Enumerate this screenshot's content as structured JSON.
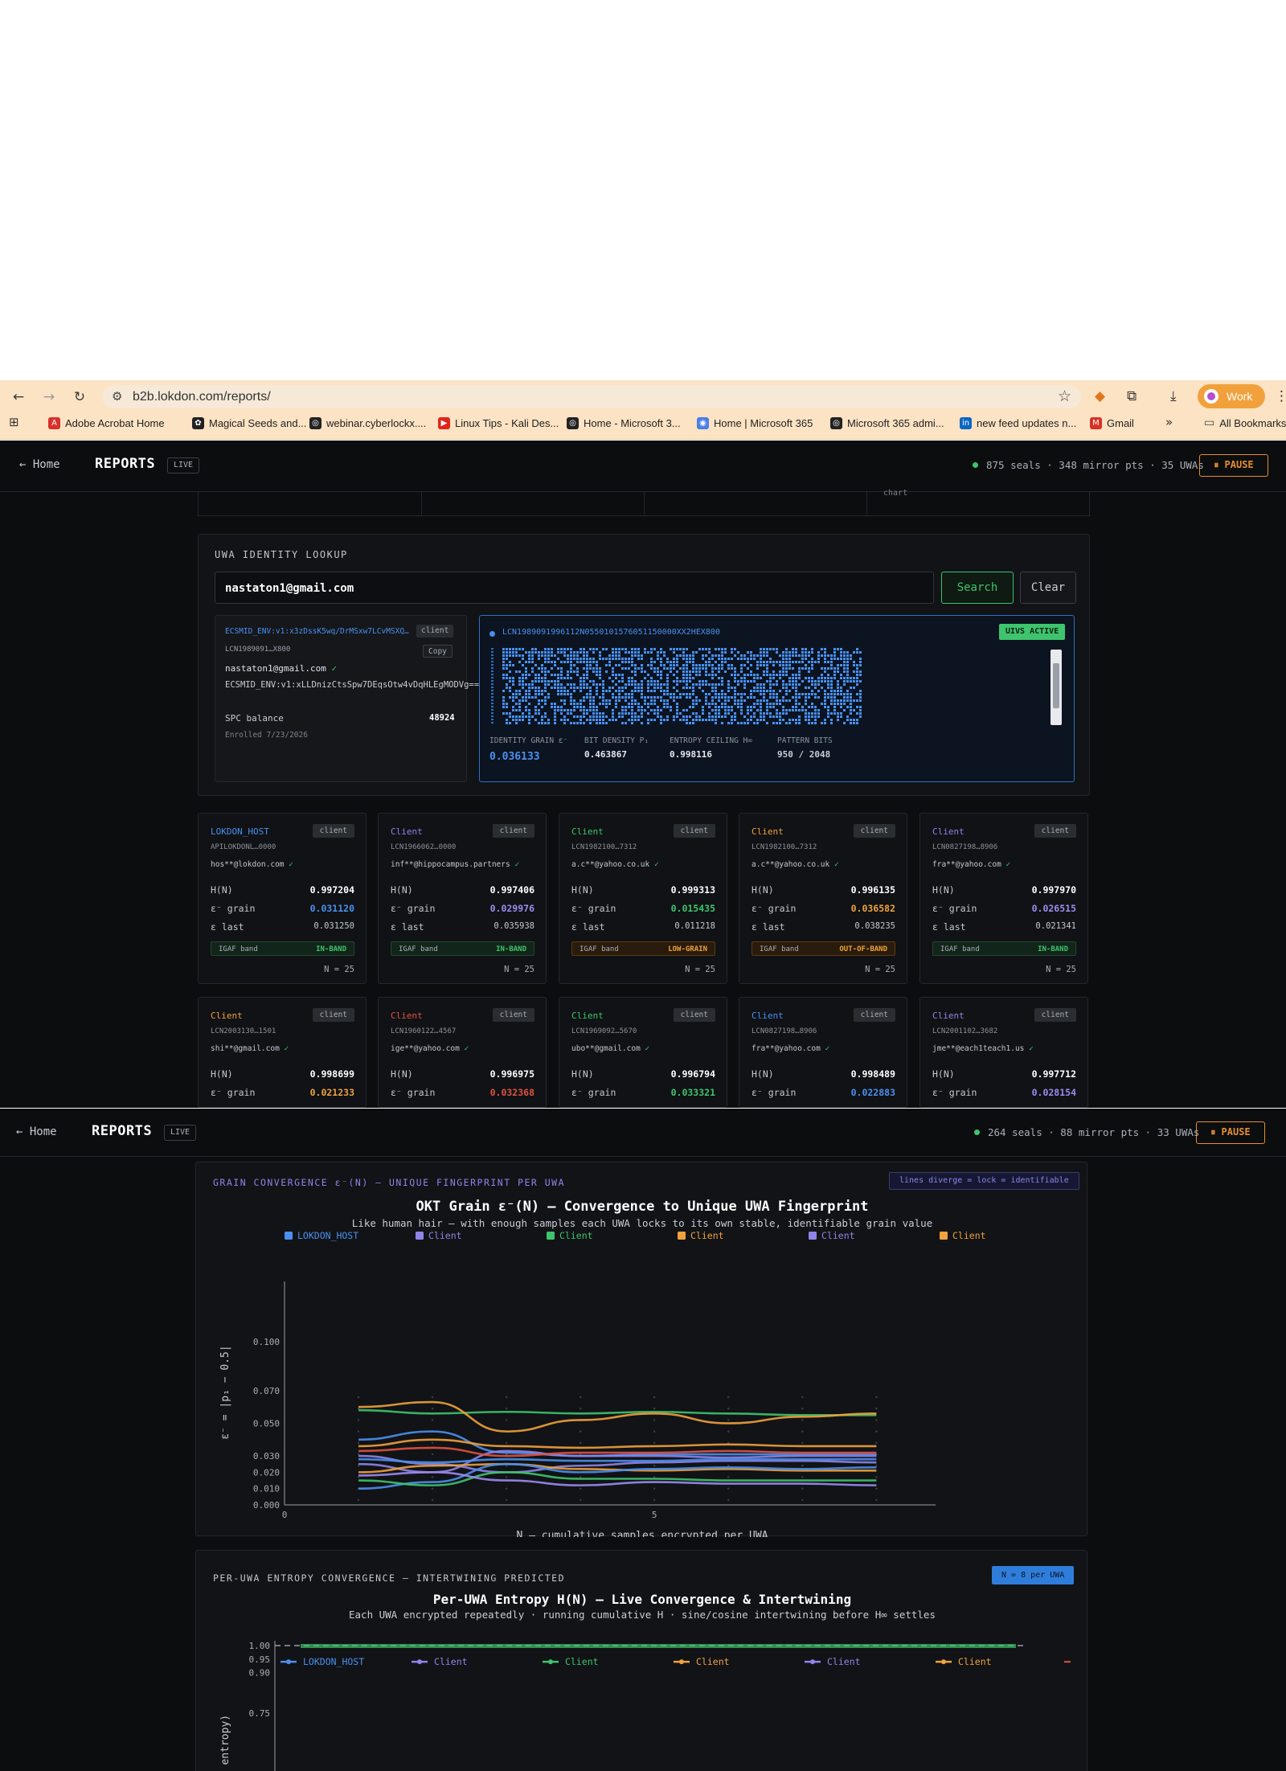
{
  "browser": {
    "url": "b2b.lokdon.com/reports/",
    "profile": "Work",
    "bookmarks": [
      {
        "label": "Adobe Acrobat Home",
        "icon": "acrobat-icon",
        "color": "#d8312a"
      },
      {
        "label": "Magical Seeds and...",
        "icon": "magical-seeds-icon",
        "color": "#222222"
      },
      {
        "label": "webinar.cyberlockx....",
        "icon": "globe-icon",
        "color": "#222222"
      },
      {
        "label": "Linux Tips - Kali Des...",
        "icon": "youtube-icon",
        "color": "#e0261b"
      },
      {
        "label": "Home - Microsoft 3...",
        "icon": "globe-icon",
        "color": "#222222"
      },
      {
        "label": "Home | Microsoft 365",
        "icon": "m365-icon",
        "color": "#4a7ee8"
      },
      {
        "label": "Microsoft 365 admi...",
        "icon": "globe-icon",
        "color": "#222222"
      },
      {
        "label": "new feed updates n...",
        "icon": "linkedin-icon",
        "color": "#0a66c2"
      },
      {
        "label": "Gmail",
        "icon": "gmail-icon",
        "color": "#d93025"
      }
    ],
    "all_bookmarks": "All Bookmarks"
  },
  "top_app": {
    "home": "← Home",
    "title": "REPORTS",
    "live": "LIVE",
    "status": "875 seals · 348 mirror pts · 35 UWAs",
    "pause": "⏸ PAUSE",
    "clipped_text": "chart"
  },
  "lookup": {
    "title": "UWA IDENTITY LOOKUP",
    "query": "nastaton1@gmail.com",
    "search": "Search",
    "clear": "Clear",
    "env_id": "ECSMID_ENV:v1:x3zDssK5wq/DrMSxw7LCvMSXQ…",
    "client_tag": "client",
    "lcn": "LCN1989091…X800",
    "copy": "Copy",
    "email": "nastaton1@gmail.com",
    "check": "✓",
    "env_full": "ECSMID_ENV:v1:xLLDnizCtsSpw7DEqsOtw4vDqHLEgMODVg==",
    "balance_label": "SPC balance",
    "balance": "48924",
    "enrolled": "Enrolled 7/23/2026",
    "fingerprint_id": "LCN1989091996112N0550101576051150000XX2HEX800",
    "uivs": "UIVS ACTIVE",
    "metrics": [
      {
        "label": "IDENTITY GRAIN ε⁻",
        "value": "0.036133",
        "color": "#4a90f0"
      },
      {
        "label": "BIT DENSITY P₁",
        "value": "0.463867",
        "color": "#e6e9ee"
      },
      {
        "label": "ENTROPY CEILING H∞",
        "value": "0.998116",
        "color": "#e6e9ee"
      },
      {
        "label": "PATTERN BITS",
        "value": "950 / 2048",
        "color": "#c9ced5"
      }
    ]
  },
  "uwa_cards": [
    {
      "name": "LOKDON_HOST",
      "color": "#4a90f0",
      "tag": "client",
      "lcn": "APILOKDONL…0000",
      "email": "hos**@lokdon.com",
      "check": "✓",
      "h_label": "H(N)",
      "h": "0.997204",
      "grain_label": "ε⁻ grain",
      "grain": "0.031120",
      "grain_color": "#4a90f0",
      "last_label": "ε last",
      "last": "0.031250",
      "band_label": "IGAF band",
      "band": "IN-BAND",
      "band_kind": "in",
      "n": "N = 25"
    },
    {
      "name": "Client",
      "color": "#8f84e8",
      "tag": "client",
      "lcn": "LCN1966062…0000",
      "email": "inf**@hippocampus.partners",
      "check": "✓",
      "h_label": "H(N)",
      "h": "0.997406",
      "grain_label": "ε⁻ grain",
      "grain": "0.029976",
      "grain_color": "#9b8cf0",
      "last_label": "ε last",
      "last": "0.035938",
      "band_label": "IGAF band",
      "band": "IN-BAND",
      "band_kind": "in",
      "n": "N = 25"
    },
    {
      "name": "Client",
      "color": "#3ec46d",
      "tag": "client",
      "lcn": "LCN1982100…7312",
      "email": "a.c**@yahoo.co.uk",
      "check": "✓",
      "h_label": "H(N)",
      "h": "0.999313",
      "grain_label": "ε⁻ grain",
      "grain": "0.015435",
      "grain_color": "#3ec46d",
      "last_label": "ε last",
      "last": "0.011218",
      "band_label": "IGAF band",
      "band": "LOW-GRAIN",
      "band_kind": "low",
      "n": "N = 25"
    },
    {
      "name": "Client",
      "color": "#f0a13c",
      "tag": "client",
      "lcn": "LCN1982100…7312",
      "email": "a.c**@yahoo.co.uk",
      "check": "✓",
      "h_label": "H(N)",
      "h": "0.996135",
      "grain_label": "ε⁻ grain",
      "grain": "0.036582",
      "grain_color": "#f0a13c",
      "last_label": "ε last",
      "last": "0.038235",
      "band_label": "IGAF band",
      "band": "OUT-OF-BAND",
      "band_kind": "out",
      "n": "N = 25"
    },
    {
      "name": "Client",
      "color": "#8f84e8",
      "tag": "client",
      "lcn": "LCN0827198…8906",
      "email": "fra**@yahoo.com",
      "check": "✓",
      "h_label": "H(N)",
      "h": "0.997970",
      "grain_label": "ε⁻ grain",
      "grain": "0.026515",
      "grain_color": "#9b8cf0",
      "last_label": "ε last",
      "last": "0.021341",
      "band_label": "IGAF band",
      "band": "IN-BAND",
      "band_kind": "in",
      "n": "N = 25"
    },
    {
      "name": "Client",
      "color": "#f0a13c",
      "tag": "client",
      "lcn": "LCN2003130…1501",
      "email": "shi**@gmail.com",
      "check": "✓",
      "h_label": "H(N)",
      "h": "0.998699",
      "grain_label": "ε⁻ grain",
      "grain": "0.021233",
      "grain_color": "#f0a13c"
    },
    {
      "name": "Client",
      "color": "#e0533f",
      "tag": "client",
      "lcn": "LCN1960122…4567",
      "email": "ige**@yahoo.com",
      "check": "✓",
      "h_label": "H(N)",
      "h": "0.996975",
      "grain_label": "ε⁻ grain",
      "grain": "0.032368",
      "grain_color": "#e0533f"
    },
    {
      "name": "Client",
      "color": "#3ec46d",
      "tag": "client",
      "lcn": "LCN1969092…5670",
      "email": "ubo**@gmail.com",
      "check": "✓",
      "h_label": "H(N)",
      "h": "0.996794",
      "grain_label": "ε⁻ grain",
      "grain": "0.033321",
      "grain_color": "#3ec46d"
    },
    {
      "name": "Client",
      "color": "#4a90f0",
      "tag": "client",
      "lcn": "LCN0827198…8906",
      "email": "fra**@yahoo.com",
      "check": "✓",
      "h_label": "H(N)",
      "h": "0.998489",
      "grain_label": "ε⁻ grain",
      "grain": "0.022883",
      "grain_color": "#4a90f0"
    },
    {
      "name": "Client",
      "color": "#8f84e8",
      "tag": "client",
      "lcn": "LCN2001102…3682",
      "email": "jme**@each1teach1.us",
      "check": "✓",
      "h_label": "H(N)",
      "h": "0.997712",
      "grain_label": "ε⁻ grain",
      "grain": "0.028154",
      "grain_color": "#9b8cf0"
    }
  ],
  "bottom_app": {
    "home": "← Home",
    "title": "REPORTS",
    "live": "LIVE",
    "status": "264 seals · 88 mirror pts · 33 UWAs",
    "pause": "⏸ PAUSE"
  },
  "grain_section": {
    "title": "GRAIN CONVERGENCE ε⁻(N) — UNIQUE FINGERPRINT PER UWA",
    "badge": "lines diverge = lock = identifiable"
  },
  "entropy_section": {
    "title": "PER-UWA ENTROPY CONVERGENCE — INTERTWINING PREDICTED",
    "badge": "N = 8 per UWA"
  },
  "chart_data": [
    {
      "type": "line",
      "title": "OKT Grain ε⁻(N) — Convergence to Unique UWA Fingerprint",
      "subtitle": "Like human hair — with enough samples each UWA locks to its own stable, identifiable grain value",
      "xlabel": "N — cumulative samples encrypted per UWA",
      "ylabel": "ε⁻ = |p₁ − 0.5|",
      "x_ticks": [
        0,
        5
      ],
      "y_ticks": [
        0.0,
        0.01,
        0.02,
        0.03,
        0.05,
        0.07,
        0.1
      ],
      "x": [
        1,
        2,
        3,
        4,
        5,
        6,
        7,
        8
      ],
      "legend_placement": "top",
      "series": [
        {
          "name": "LOKDON_HOST",
          "color": "#4a90f0",
          "values": [
            0.04,
            0.045,
            0.032,
            0.03,
            0.031,
            0.031,
            0.031,
            0.031
          ]
        },
        {
          "name": "Client",
          "color": "#8f84e8",
          "values": [
            0.025,
            0.02,
            0.033,
            0.03,
            0.03,
            0.029,
            0.03,
            0.03
          ]
        },
        {
          "name": "Client",
          "color": "#3ec46d",
          "values": [
            0.058,
            0.056,
            0.057,
            0.056,
            0.057,
            0.056,
            0.055,
            0.055
          ]
        },
        {
          "name": "Client",
          "color": "#f0a13c",
          "values": [
            0.06,
            0.063,
            0.045,
            0.052,
            0.056,
            0.05,
            0.054,
            0.056
          ]
        },
        {
          "name": "Client",
          "color": "#8f84e8",
          "values": [
            0.03,
            0.025,
            0.02,
            0.024,
            0.026,
            0.027,
            0.027,
            0.026
          ]
        },
        {
          "name": "Client",
          "color": "#f0a13c",
          "values": [
            0.02,
            0.024,
            0.025,
            0.022,
            0.021,
            0.022,
            0.021,
            0.021
          ]
        },
        {
          "name": "",
          "color": "#4a90f0",
          "values": [
            0.01,
            0.014,
            0.025,
            0.02,
            0.022,
            0.023,
            0.022,
            0.023
          ]
        },
        {
          "name": "",
          "color": "#3ec46d",
          "values": [
            0.015,
            0.012,
            0.02,
            0.016,
            0.016,
            0.015,
            0.015,
            0.015
          ]
        },
        {
          "name": "",
          "color": "#e0533f",
          "values": [
            0.033,
            0.035,
            0.03,
            0.032,
            0.032,
            0.033,
            0.032,
            0.032
          ]
        },
        {
          "name": "",
          "color": "#9b8cf0",
          "values": [
            0.018,
            0.02,
            0.015,
            0.012,
            0.014,
            0.013,
            0.013,
            0.012
          ]
        },
        {
          "name": "",
          "color": "#f0a13c",
          "values": [
            0.036,
            0.04,
            0.036,
            0.035,
            0.036,
            0.037,
            0.036,
            0.036
          ]
        },
        {
          "name": "",
          "color": "#4a90f0",
          "values": [
            0.028,
            0.026,
            0.028,
            0.027,
            0.027,
            0.028,
            0.028,
            0.028
          ]
        }
      ]
    },
    {
      "type": "line",
      "title": "Per-UWA Entropy H(N) — Live Convergence & Intertwining",
      "subtitle": "Each UWA encrypted repeatedly · running cumulative H · sine/cosine intertwining before H∞ settles",
      "ylabel": "it entropy)",
      "y_ticks": [
        0.75,
        0.9,
        0.95,
        1.0
      ],
      "legend_placement": "top",
      "series": [
        {
          "name": "LOKDON_HOST",
          "color": "#4a90f0"
        },
        {
          "name": "Client",
          "color": "#8f84e8"
        },
        {
          "name": "Client",
          "color": "#3ec46d"
        },
        {
          "name": "Client",
          "color": "#f0a13c"
        },
        {
          "name": "Client",
          "color": "#8f84e8"
        },
        {
          "name": "Client",
          "color": "#f0a13c"
        }
      ]
    }
  ]
}
